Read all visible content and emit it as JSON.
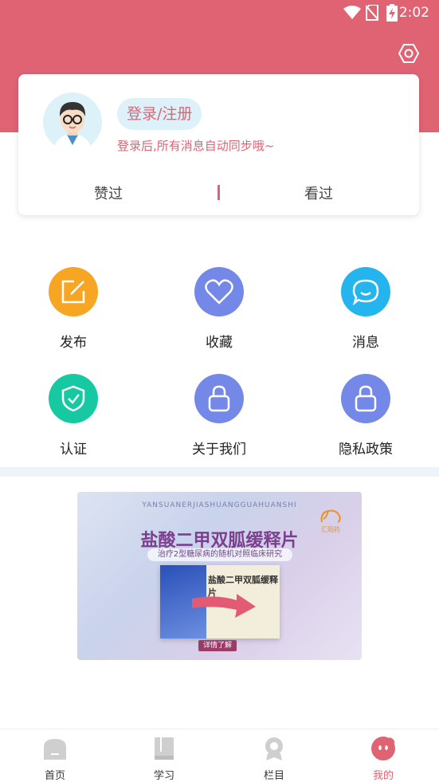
{
  "status_bar": {
    "time": "2:02"
  },
  "profile": {
    "login_label": "登录/注册",
    "hint": "登录后,所有消息自动同步哦~",
    "tabs": [
      "赞过",
      "看过"
    ]
  },
  "grid": [
    {
      "label": "发布",
      "color": "#F6A623",
      "icon": "edit-icon"
    },
    {
      "label": "收藏",
      "color": "#7488E8",
      "icon": "heart-icon"
    },
    {
      "label": "消息",
      "color": "#24B5EF",
      "icon": "chat-icon"
    },
    {
      "label": "认证",
      "color": "#16C9A3",
      "icon": "shield-check-icon"
    },
    {
      "label": "关于我们",
      "color": "#7488E8",
      "icon": "lock-icon"
    },
    {
      "label": "隐私政策",
      "color": "#7488E8",
      "icon": "lock-icon"
    }
  ],
  "banner": {
    "pinyin": "YANSUANERJIASHUANGGUAHUANSHI",
    "title": "盐酸二甲双胍缓释片",
    "note": "治疗2型糖尿病的随机对照临床研究",
    "pack_name": "盐酸二甲双胍缓释片",
    "detail_button": "详情了解",
    "logo_text": "汇阳药"
  },
  "nav": [
    {
      "label": "首页",
      "icon": "home-icon",
      "active": false
    },
    {
      "label": "学习",
      "icon": "book-icon",
      "active": false
    },
    {
      "label": "栏目",
      "icon": "badge-icon",
      "active": false
    },
    {
      "label": "我的",
      "icon": "profile-face-icon",
      "active": true
    }
  ],
  "colors": {
    "brand": "#E06374",
    "accent_bg": "#DDF1F8"
  }
}
